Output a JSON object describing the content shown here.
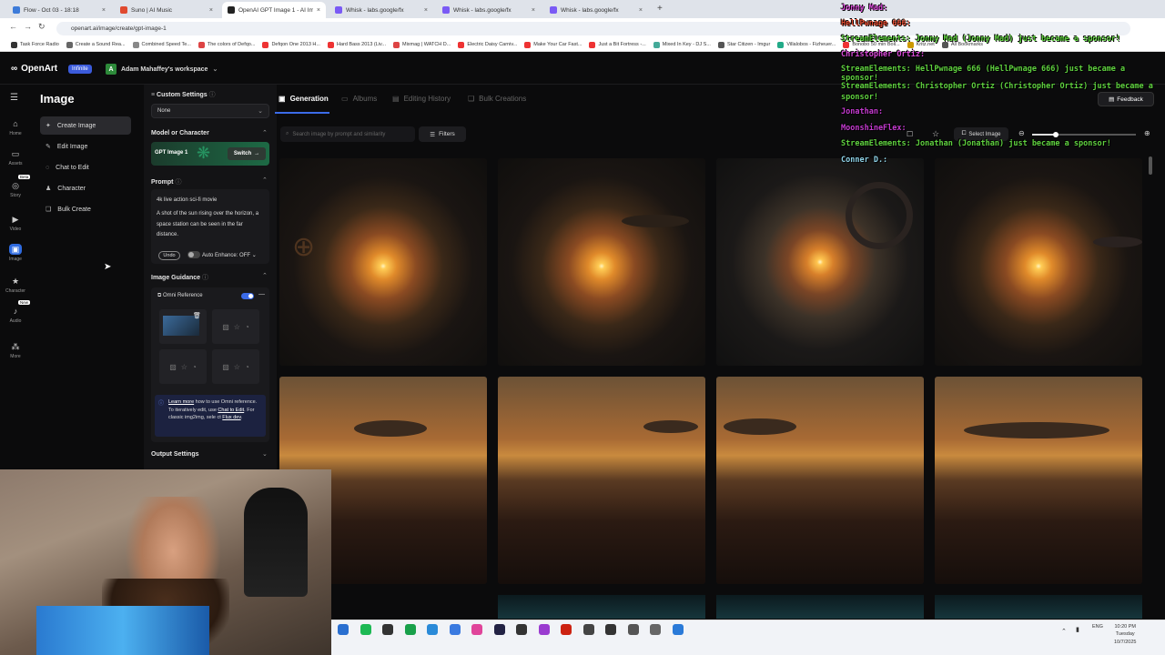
{
  "browser": {
    "tabs": [
      {
        "title": "Flow - Oct 03 - 18:18",
        "color": "#3d7bd9"
      },
      {
        "title": "Suno | AI Music",
        "color": "#e04a2f"
      },
      {
        "title": "OpenAI GPT Image 1 - AI Imag...",
        "color": "#222222",
        "active": true
      },
      {
        "title": "Whisk - labs.google/fx",
        "color": "#7a5af5"
      },
      {
        "title": "Whisk - labs.google/fx",
        "color": "#7a5af5"
      },
      {
        "title": "Whisk - labs.google/fx",
        "color": "#7a5af5"
      }
    ],
    "url": "openart.ai/image/create/gpt-image-1",
    "bookmarks": [
      "Task Force Radio",
      "Create a Sound Rea...",
      "Combined Speed Te...",
      "The colors of Defqo...",
      "Defqon One 2013 H...",
      "Hard Bass 2013 (Liv...",
      "Mixmag | WATCH D...",
      "Electric Daisy Carniv...",
      "Make Your Car Fast...",
      "Just a Bit Fortress -...",
      "Mixed In Key - DJ S...",
      "Star Citizen - Imgur",
      "Villalobos - Fizheuer...",
      "Bonobo 50 min Boil...",
      "Kritz.net",
      "All Bookmarks"
    ]
  },
  "app": {
    "logo": "OpenArt",
    "plan_badge": "Infinite",
    "workspace_initial": "A",
    "workspace": "Adam Mahaffey's workspace"
  },
  "rail": [
    {
      "label": "Home",
      "icon": "home-icon",
      "glyph": "⌂"
    },
    {
      "label": "Assets",
      "icon": "folder-icon",
      "glyph": "▭"
    },
    {
      "label": "Story",
      "icon": "story-icon",
      "glyph": "◎",
      "badge": "Beta"
    },
    {
      "label": "Video",
      "icon": "video-icon",
      "glyph": "▶"
    },
    {
      "label": "Image",
      "icon": "image-icon",
      "glyph": "▣",
      "active": true
    },
    {
      "label": "Character",
      "icon": "character-icon",
      "glyph": "★"
    },
    {
      "label": "Audio",
      "icon": "audio-icon",
      "glyph": "♪",
      "badge": "New"
    },
    {
      "label": "More",
      "icon": "grid-icon",
      "glyph": "⁂"
    }
  ],
  "image_menu": {
    "title": "Image",
    "items": [
      {
        "label": "Create Image",
        "glyph": "✦",
        "active": true
      },
      {
        "label": "Edit Image",
        "glyph": "✎"
      },
      {
        "label": "Chat to Edit",
        "glyph": "◌"
      },
      {
        "label": "Character",
        "glyph": "♟"
      },
      {
        "label": "Bulk Create",
        "glyph": "❑"
      }
    ]
  },
  "settings": {
    "custom_settings": "Custom Settings",
    "custom_value": "None",
    "model_heading": "Model or Character",
    "model_name": "GPT Image 1",
    "switch_label": "Switch",
    "prompt_heading": "Prompt",
    "prompt_line1": "4k live action sci-fi movie",
    "prompt_line2": "A shot of the sun rising over the horizon, a space station can be seen in the far distance.",
    "undo": "Undo",
    "auto_enhance": "Auto Enhance: OFF",
    "guidance_heading": "Image Guidance",
    "omni_reference": "Omni Reference",
    "learn_more": "Learn more",
    "info_text1": " how to use Omni reference. To iteratively edit, use ",
    "chat_to_edit": "Chat to Edit",
    "info_text2": ". For classic img2img, sele ct ",
    "flux_dev": "Flux dev",
    "info_text3": ".",
    "output_heading": "Output Settings"
  },
  "main": {
    "tabs": [
      "Generation",
      "Albums",
      "Editing History",
      "Bulk Creations"
    ],
    "search_placeholder": "Search image by prompt and similarity",
    "filters": "Filters",
    "select_image": "Select Image",
    "feedback": "Feedback"
  },
  "chat": [
    {
      "text": "Jonny Mad:",
      "color": "#d94ad9"
    },
    {
      "text": "HellPwnage 666:",
      "color": "#e04a2f"
    },
    {
      "text": "StreamElements: Jonny Mad (Jonny Mad) just became a sponsor!",
      "color": "#5fd13f"
    },
    {
      "text": "Christopher Ortiz:",
      "color": "#d94ad9"
    },
    {
      "text": "StreamElements: HellPwnage 666 (HellPwnage 666) just became a sponsor!",
      "color": "#5fd13f"
    },
    {
      "text": "StreamElements: Christopher Ortiz (Christopher Ortiz) just became a sponsor!",
      "color": "#5fd13f"
    },
    {
      "text": "Jonathan:",
      "color": "#c53ad0"
    },
    {
      "text": "MoonshineFlex:",
      "color": "#c53ad0"
    },
    {
      "text": "StreamElements: Jonathan (Jonathan) just became a sponsor!",
      "color": "#5fd13f"
    },
    {
      "text": "Conner D.:",
      "color": "#8fd3e8"
    }
  ],
  "taskbar": {
    "lang": "ENG",
    "time": "10:20 PM",
    "day": "Tuesday",
    "date": "10/7/2025"
  }
}
